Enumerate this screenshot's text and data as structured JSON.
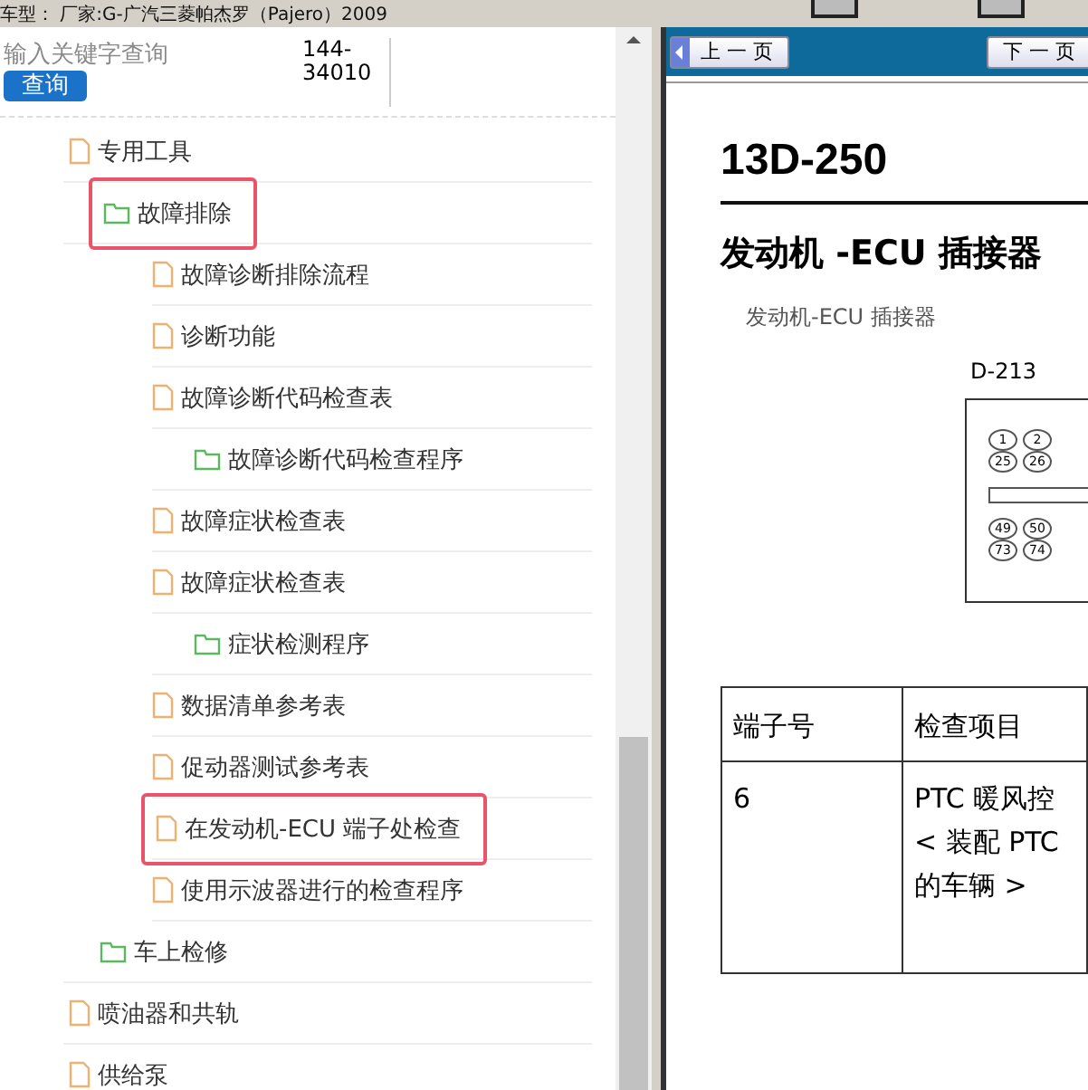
{
  "top_bar": {
    "vehicle": "车型： 厂家:G-广汽三菱帕杰罗（Pajero）2009"
  },
  "search": {
    "placeholder": "输入关键字查询",
    "button": "查询",
    "code": "144-34010"
  },
  "tree": [
    {
      "label": "专用工具",
      "kind": "file",
      "highlighted": false
    },
    {
      "label": "故障排除",
      "kind": "folder",
      "highlighted": true,
      "children": [
        {
          "label": "故障诊断排除流程",
          "kind": "file",
          "highlighted": false
        },
        {
          "label": "诊断功能",
          "kind": "file",
          "highlighted": false
        },
        {
          "label": "故障诊断代码检查表",
          "kind": "file",
          "highlighted": false,
          "children": [
            {
              "label": "故障诊断代码检查程序",
              "kind": "folder",
              "highlighted": false
            }
          ]
        },
        {
          "label": "故障症状检查表",
          "kind": "file",
          "highlighted": false
        },
        {
          "label": "故障症状检查表",
          "kind": "file",
          "highlighted": false,
          "children": [
            {
              "label": "症状检测程序",
              "kind": "folder",
              "highlighted": false
            }
          ]
        },
        {
          "label": "数据清单参考表",
          "kind": "file",
          "highlighted": false
        },
        {
          "label": "促动器测试参考表",
          "kind": "file",
          "highlighted": false
        },
        {
          "label": "在发动机-ECU 端子处检查",
          "kind": "file",
          "highlighted": true
        },
        {
          "label": "使用示波器进行的检查程序",
          "kind": "file",
          "highlighted": false
        }
      ]
    },
    {
      "label": "车上检修",
      "kind": "folder",
      "highlighted": false
    },
    {
      "label": "喷油器和共轨",
      "kind": "file",
      "highlighted": false
    },
    {
      "label": "供给泵",
      "kind": "file",
      "highlighted": false
    }
  ],
  "nav": {
    "prev": "上 一 页",
    "next": "下 一 页"
  },
  "document": {
    "page_number": "13D-250",
    "heading": "发动机 -ECU 插接器",
    "subheading": "发动机-ECU 插接器",
    "connector": {
      "label": "D-213",
      "pin_rows": [
        [
          "1",
          "2"
        ],
        [
          "25",
          "26"
        ],
        [
          "49",
          "50"
        ],
        [
          "73",
          "74"
        ]
      ]
    },
    "table": {
      "columns": [
        "端子号",
        "检查项目"
      ],
      "rows": [
        {
          "terminal": "6",
          "item_lines": [
            "PTC 暖风控",
            "< 装配 PTC",
            "的车辆 >"
          ]
        }
      ]
    }
  }
}
